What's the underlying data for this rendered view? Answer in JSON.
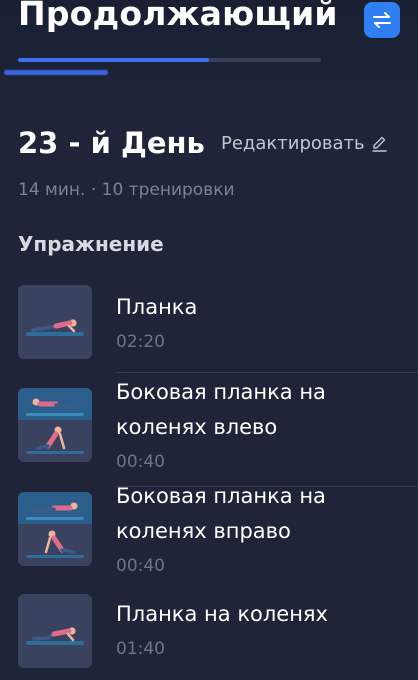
{
  "header": {
    "title": "Продолжающий",
    "switch_icon": "swap-arrows-icon",
    "accent_color": "#2f7ff2",
    "plan_progress": 0.63
  },
  "day": {
    "title": "23 - й День",
    "edit_label": "Редактировать",
    "edit_icon": "pencil-icon",
    "meta": "14 мин. · 10 тренировки"
  },
  "section": {
    "title": "Упражнение"
  },
  "exercises": [
    {
      "name_line1": "Планка",
      "name_line2": "",
      "time": "02:20",
      "thumbnail": "plank-figure-icon"
    },
    {
      "name_line1": "Боковая планка на",
      "name_line2": "коленях влево",
      "time": "00:40",
      "thumbnail": "side-plank-figure-icon"
    },
    {
      "name_line1": "Боковая планка на",
      "name_line2": "коленях вправо",
      "time": "00:40",
      "thumbnail": "side-plank-figure-icon"
    },
    {
      "name_line1": "Планка на коленях",
      "name_line2": "",
      "time": "01:40",
      "thumbnail": "knee-plank-figure-icon"
    }
  ]
}
